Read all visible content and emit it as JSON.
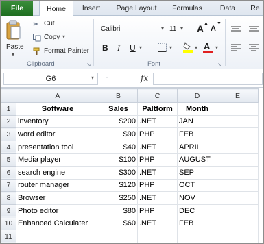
{
  "tabs": [
    "File",
    "Home",
    "Insert",
    "Page Layout",
    "Formulas",
    "Data",
    "Re"
  ],
  "clipboard": {
    "paste_label": "Paste",
    "cut_label": "Cut",
    "copy_label": "Copy",
    "format_painter_label": "Format Painter",
    "group_label": "Clipboard"
  },
  "font": {
    "name": "Calibri",
    "size": "11",
    "group_label": "Font",
    "bold": "B",
    "italic": "I",
    "underline": "U",
    "grow": "A",
    "shrink": "A",
    "color_letter": "A"
  },
  "formula_bar": {
    "name_box": "G6",
    "fx": "fx",
    "formula": ""
  },
  "columns": [
    "A",
    "B",
    "C",
    "D",
    "E"
  ],
  "rows": [
    {
      "n": "1",
      "a": "Software",
      "b": "Sales",
      "c": "Paltform",
      "d": "Month"
    },
    {
      "n": "2",
      "a": "inventory",
      "b": "$200",
      "c": ".NET",
      "d": "JAN"
    },
    {
      "n": "3",
      "a": "word editor",
      "b": "$90",
      "c": "PHP",
      "d": "FEB"
    },
    {
      "n": "4",
      "a": "presentation tool",
      "b": "$40",
      "c": ".NET",
      "d": "APRIL"
    },
    {
      "n": "5",
      "a": "Media player",
      "b": "$100",
      "c": "PHP",
      "d": "AUGUST"
    },
    {
      "n": "6",
      "a": "search engine",
      "b": "$300",
      "c": ".NET",
      "d": "SEP"
    },
    {
      "n": "7",
      "a": "router manager",
      "b": "$120",
      "c": "PHP",
      "d": "OCT"
    },
    {
      "n": "8",
      "a": "Browser",
      "b": "$250",
      "c": ".NET",
      "d": "NOV"
    },
    {
      "n": "9",
      "a": "Photo editor",
      "b": "$80",
      "c": "PHP",
      "d": "DEC"
    },
    {
      "n": "10",
      "a": "Enhanced Calculater",
      "b": "$60",
      "c": ".NET",
      "d": "FEB"
    },
    {
      "n": "11",
      "a": "",
      "b": "",
      "c": "",
      "d": ""
    }
  ]
}
